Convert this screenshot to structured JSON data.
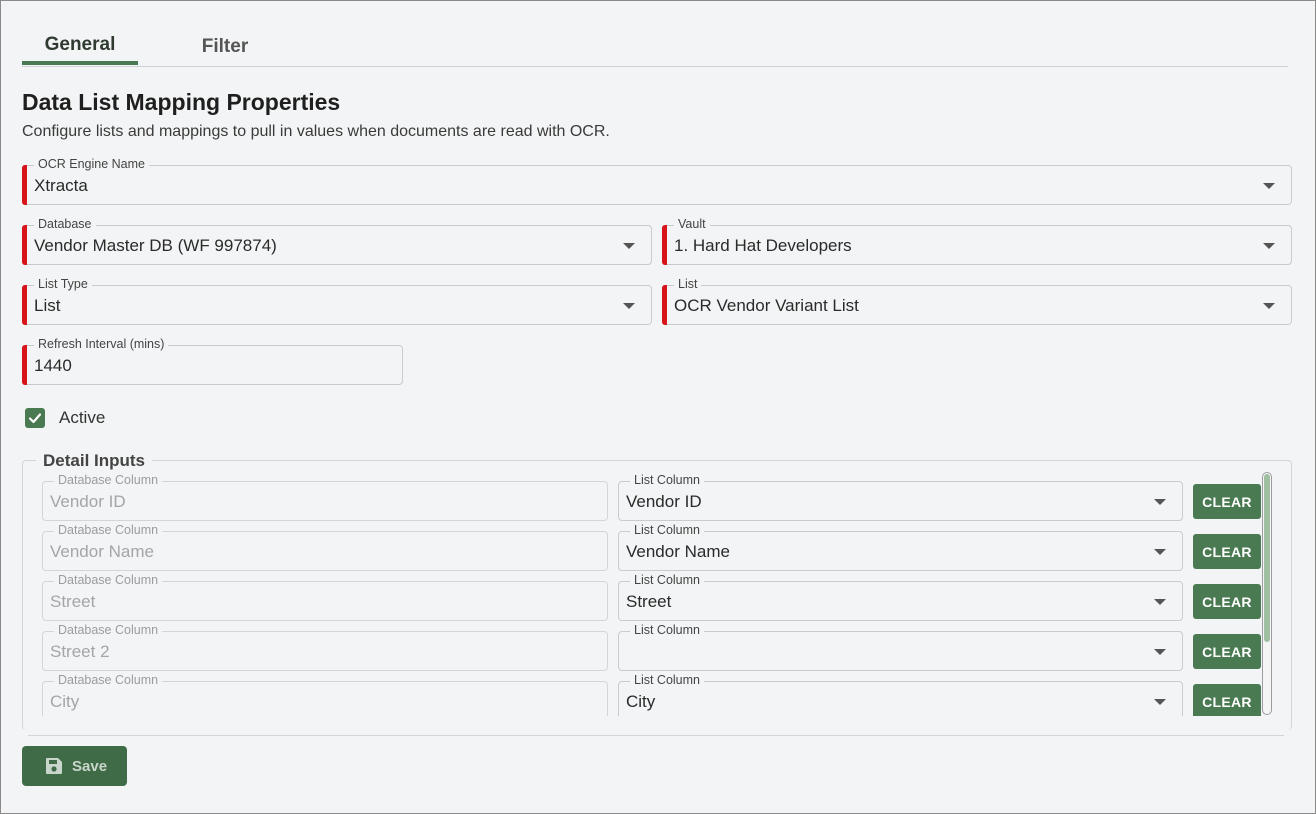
{
  "tabs": [
    {
      "label": "General",
      "active": true
    },
    {
      "label": "Filter",
      "active": false
    }
  ],
  "header": {
    "title": "Data List Mapping Properties",
    "subtitle": "Configure lists and mappings to pull in values when documents are read with OCR."
  },
  "form": {
    "ocr_engine": {
      "label": "OCR Engine Name",
      "value": "Xtracta"
    },
    "database": {
      "label": "Database",
      "value": "Vendor Master DB (WF 997874)"
    },
    "vault": {
      "label": "Vault",
      "value": "1. Hard Hat Developers"
    },
    "list_type": {
      "label": "List Type",
      "value": "List"
    },
    "list": {
      "label": "List",
      "value": "OCR Vendor Variant List"
    },
    "refresh_interval": {
      "label": "Refresh Interval (mins)",
      "value": "1440"
    },
    "active": {
      "label": "Active",
      "checked": true
    }
  },
  "detail_inputs": {
    "legend": "Detail Inputs",
    "db_column_label": "Database Column",
    "list_column_label": "List Column",
    "clear_label": "CLEAR",
    "rows": [
      {
        "db_column": "Vendor ID",
        "list_column": "Vendor ID"
      },
      {
        "db_column": "Vendor Name",
        "list_column": "Vendor Name"
      },
      {
        "db_column": "Street",
        "list_column": "Street"
      },
      {
        "db_column": "Street 2",
        "list_column": ""
      },
      {
        "db_column": "City",
        "list_column": "City"
      }
    ]
  },
  "footer": {
    "save_label": "Save"
  },
  "colors": {
    "accent": "#4a7a52",
    "required": "#d7141a"
  }
}
